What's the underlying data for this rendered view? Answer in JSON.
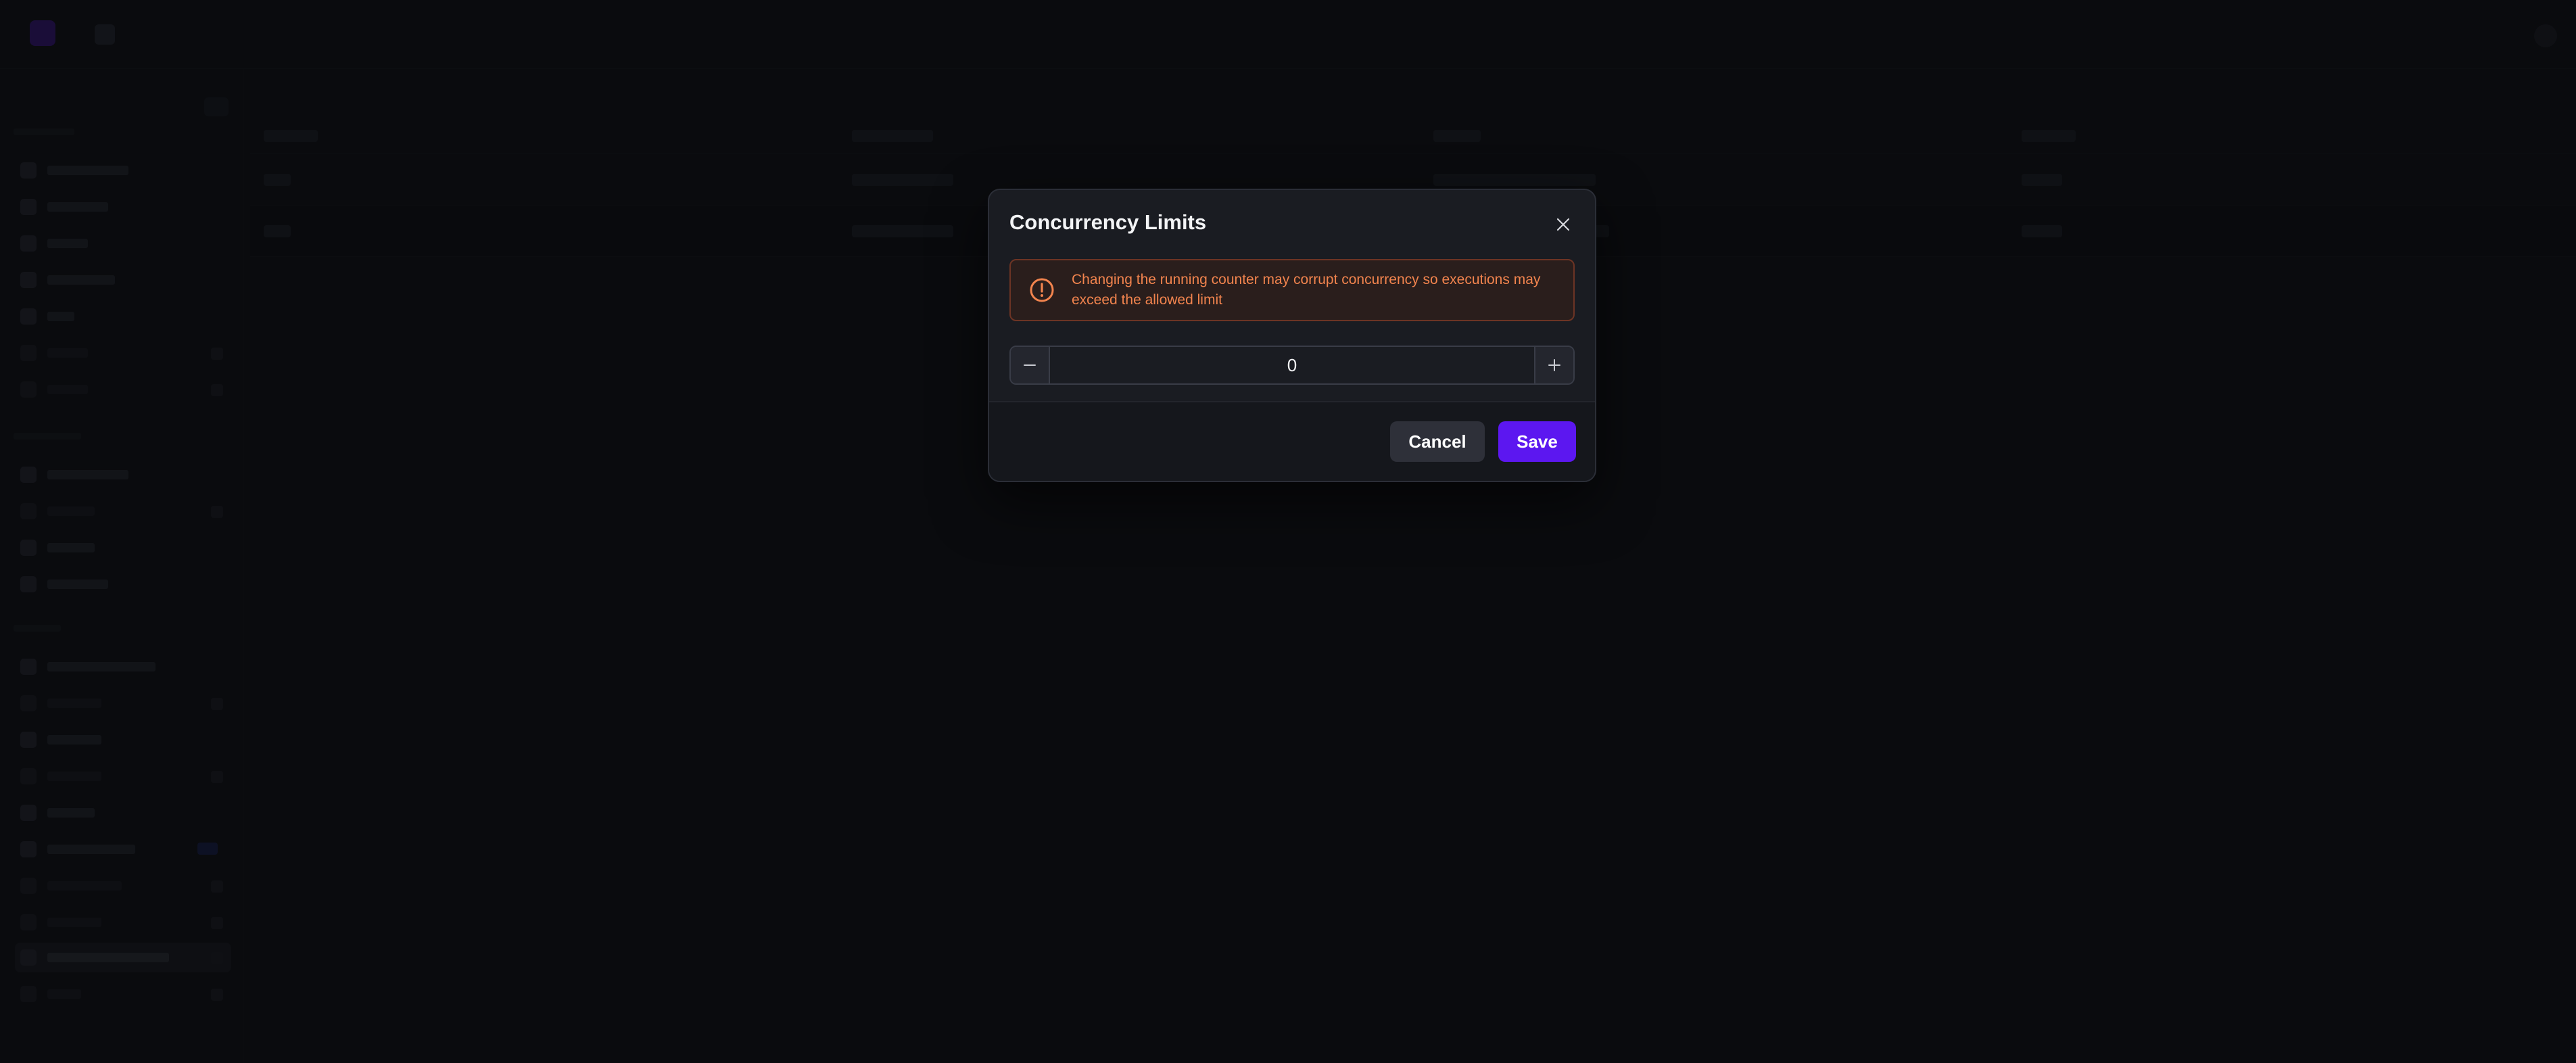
{
  "modal": {
    "title": "Concurrency Limits",
    "warning": "Changing the running counter may corrupt concurrency so executions may exceed the allowed limit",
    "counter_value": "0",
    "cancel_label": "Cancel",
    "save_label": "Save"
  },
  "colors": {
    "accent": "#5c17f0",
    "warning": "#f2844e",
    "warning_border": "#6d3424"
  },
  "icons": {
    "close": "close-icon",
    "warning": "alert-circle-icon",
    "decrement": "minus-icon",
    "increment": "plus-icon"
  }
}
